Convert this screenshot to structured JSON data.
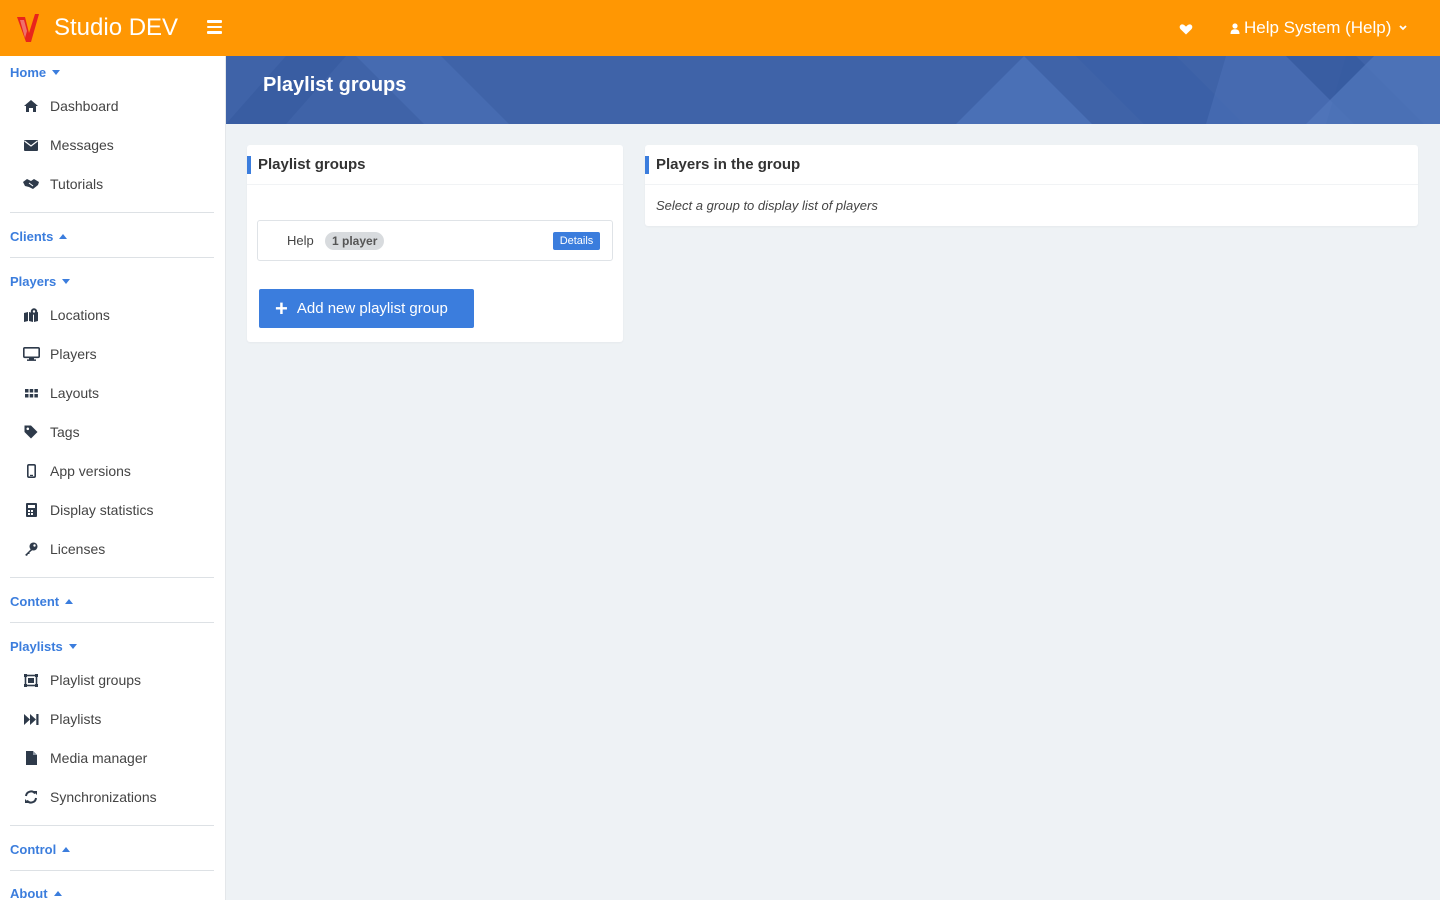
{
  "app": {
    "brand": "Studio DEV"
  },
  "header": {
    "user_label": "Help System (Help)"
  },
  "sidebar": {
    "home": {
      "label": "Home",
      "items": [
        "Dashboard",
        "Messages",
        "Tutorials"
      ]
    },
    "clients": {
      "label": "Clients"
    },
    "players": {
      "label": "Players",
      "items": [
        "Locations",
        "Players",
        "Layouts",
        "Tags",
        "App versions",
        "Display statistics",
        "Licenses"
      ]
    },
    "content": {
      "label": "Content"
    },
    "playlists": {
      "label": "Playlists",
      "items": [
        "Playlist groups",
        "Playlists",
        "Media manager",
        "Synchronizations"
      ]
    },
    "control": {
      "label": "Control"
    },
    "about": {
      "label": "About"
    }
  },
  "page": {
    "title": "Playlist groups"
  },
  "groups_card": {
    "title": "Playlist groups",
    "groups": [
      {
        "name": "Help",
        "badge": "1 player",
        "action": "Details"
      }
    ],
    "add_button": "Add new playlist group"
  },
  "players_card": {
    "title": "Players in the group",
    "hint": "Select a group to display list of players"
  },
  "colors": {
    "topbar": "#ff9703",
    "accent": "#3b7ddd",
    "banner": "#3f63a8",
    "background": "#eef2f5"
  }
}
